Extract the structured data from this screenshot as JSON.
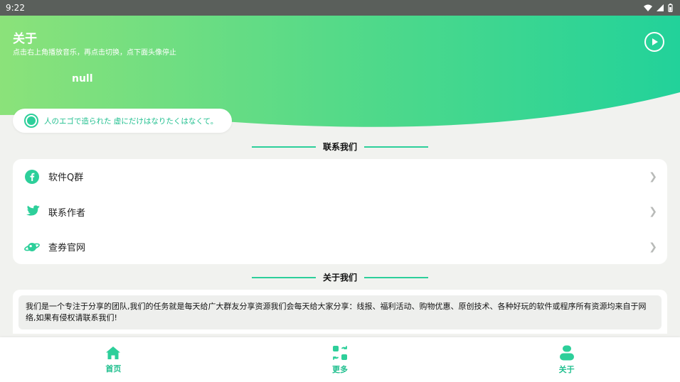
{
  "status_bar": {
    "time": "9:22"
  },
  "header": {
    "title": "关于",
    "subtitle": "点击右上角播放音乐，再点击切换，点下面头像停止",
    "name": "null"
  },
  "quote": {
    "text": "人のエゴで造られた 虚にだけはなりたくはなくて。"
  },
  "contact_section": {
    "heading": "联系我们",
    "items": [
      {
        "label": "软件Q群",
        "icon": "facebook-icon"
      },
      {
        "label": "联系作者",
        "icon": "twitter-icon"
      },
      {
        "label": "查券官网",
        "icon": "planet-icon"
      }
    ]
  },
  "about_section": {
    "heading": "关于我们",
    "text": "我们是一个专注于分享的团队,我们的任务就是每天给广大群友分享资源我们会每天给大家分享：线报、福利活动、购物优惠、原创技术、各种好玩的软件或程序所有资源均来自于网络,如果有侵权请联系我们!"
  },
  "bottom_nav": [
    {
      "label": "首页",
      "icon": "home-icon"
    },
    {
      "label": "更多",
      "icon": "more-icon"
    },
    {
      "label": "关于",
      "icon": "user-icon"
    }
  ],
  "colors": {
    "accent": "#2dcf9a",
    "gradient_start": "#8be27a",
    "gradient_end": "#22d29a"
  }
}
